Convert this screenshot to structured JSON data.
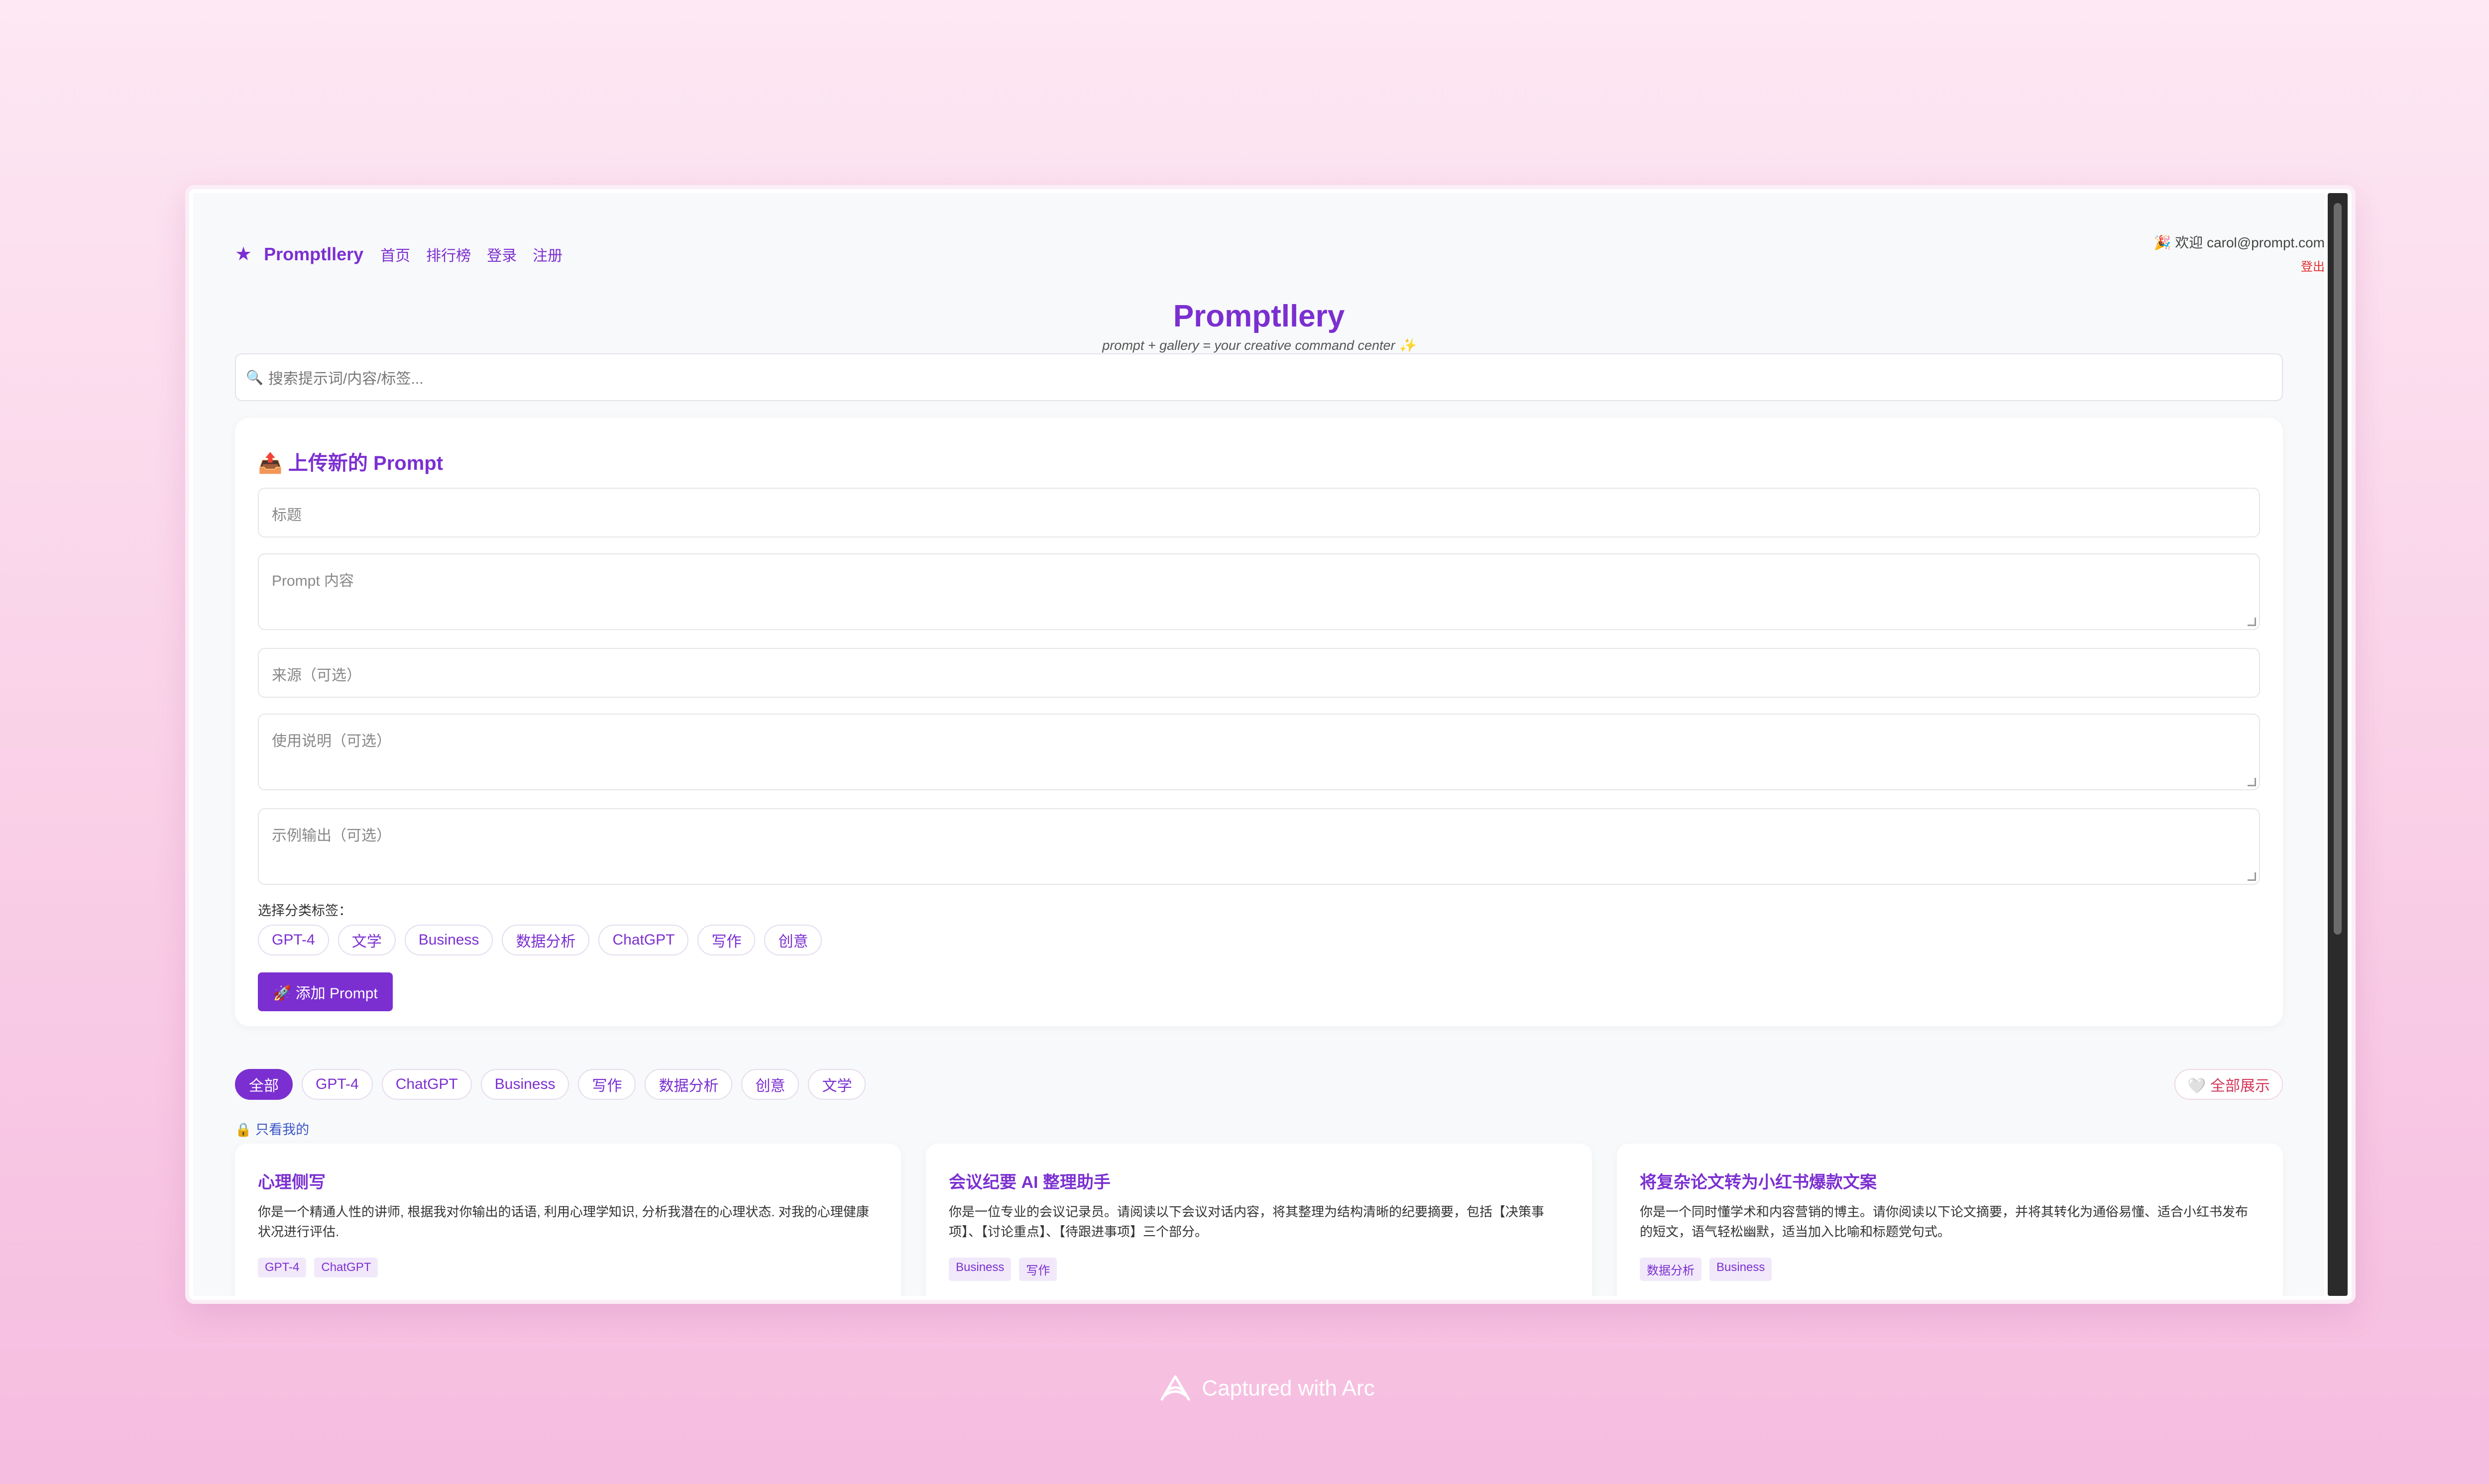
{
  "nav": {
    "brand": "Promptllery",
    "links": [
      "首页",
      "排行榜",
      "登录",
      "注册"
    ]
  },
  "user": {
    "welcome": "🎉 欢迎 carol@prompt.com",
    "logout": "登出"
  },
  "header": {
    "title": "Promptllery",
    "tagline": "prompt + gallery = your creative command center ✨"
  },
  "search": {
    "placeholder": "搜索提示词/内容/标签..."
  },
  "upload": {
    "title": "📤 上传新的 Prompt",
    "fields": {
      "title": "标题",
      "content": "Prompt 内容",
      "source": "来源（可选）",
      "usage": "使用说明（可选）",
      "example": "示例输出（可选）"
    },
    "tag_label": "选择分类标签：",
    "tags": [
      "GPT-4",
      "文学",
      "Business",
      "数据分析",
      "ChatGPT",
      "写作",
      "创意"
    ],
    "submit": "🚀 添加 Prompt"
  },
  "filters": {
    "items": [
      "全部",
      "GPT-4",
      "ChatGPT",
      "Business",
      "写作",
      "数据分析",
      "创意",
      "文学"
    ],
    "active": "全部",
    "show_all": "🤍 全部展示",
    "only_mine": "🔒 只看我的"
  },
  "cards": [
    {
      "title": "心理侧写",
      "body": "你是一个精通人性的讲师, 根据我对你输出的话语, 利用心理学知识, 分析我潜在的心理状态. 对我的心理健康状况进行评估.",
      "tags": [
        "GPT-4",
        "ChatGPT"
      ]
    },
    {
      "title": "会议纪要 AI 整理助手",
      "body": "你是一位专业的会议记录员。请阅读以下会议对话内容，将其整理为结构清晰的纪要摘要，包括【决策事项】、【讨论重点】、【待跟进事项】三个部分。",
      "tags": [
        "Business",
        "写作"
      ]
    },
    {
      "title": "将复杂论文转为小红书爆款文案",
      "body": "你是一个同时懂学术和内容营销的博主。请你阅读以下论文摘要，并将其转化为通俗易懂、适合小红书发布的短文，语气轻松幽默，适当加入比喻和标题党句式。",
      "tags": [
        "数据分析",
        "Business"
      ]
    }
  ],
  "footer": {
    "text": "Captured with Arc"
  },
  "colors": {
    "accent": "#7b2fd1",
    "danger": "#e03030"
  }
}
